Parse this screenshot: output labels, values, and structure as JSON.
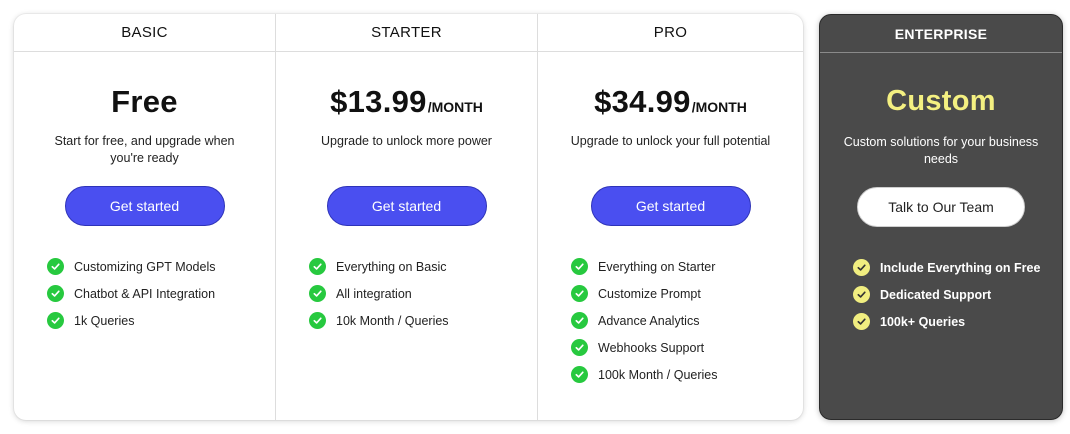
{
  "plans": [
    {
      "name": "BASIC",
      "price": "Free",
      "per": "",
      "description": "Start for free, and upgrade when you're ready",
      "cta": "Get started",
      "features": [
        "Customizing GPT Models",
        "Chatbot & API Integration",
        "1k Queries"
      ]
    },
    {
      "name": "STARTER",
      "price": "$13.99",
      "per": "/MONTH",
      "description": "Upgrade to unlock more power",
      "cta": "Get started",
      "features": [
        "Everything on Basic",
        "All integration",
        "10k Month / Queries"
      ]
    },
    {
      "name": "PRO",
      "price": "$34.99",
      "per": "/MONTH",
      "description": "Upgrade to unlock your full potential",
      "cta": "Get started",
      "features": [
        "Everything on Starter",
        "Customize Prompt",
        "Advance Analytics",
        "Webhooks Support",
        "100k Month / Queries"
      ]
    },
    {
      "name": "ENTERPRISE",
      "price": "Custom",
      "description": "Custom solutions for your business needs",
      "cta": "Talk to Our Team",
      "features": [
        "Include Everything on Free",
        "Dedicated Support",
        "100k+ Queries"
      ]
    }
  ],
  "icons": {
    "feature_check": "check-circle-icon"
  },
  "colors": {
    "primary_button": "#4a4ff0",
    "check_green": "#27c93f",
    "enterprise_bg": "#4a4a4a",
    "enterprise_accent": "#f4f081"
  }
}
